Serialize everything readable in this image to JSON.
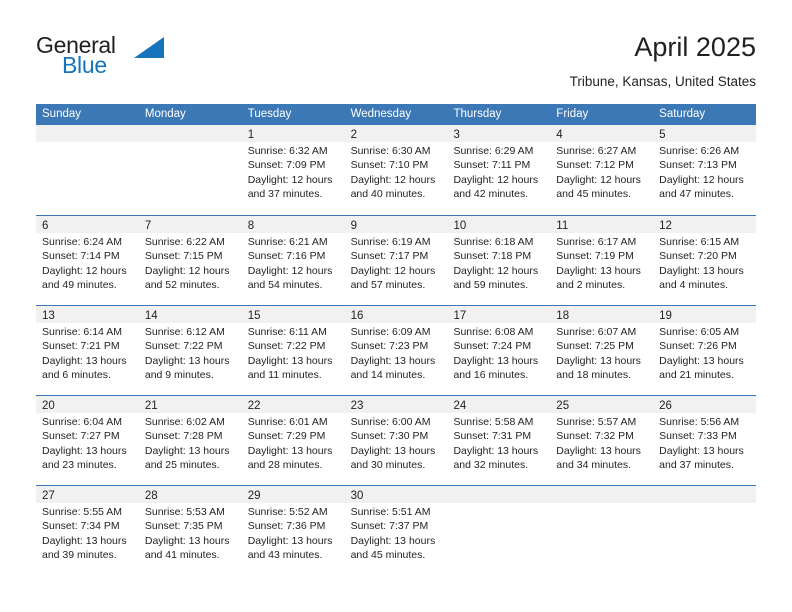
{
  "brand": {
    "word1": "General",
    "word2": "Blue",
    "triangle_color": "#1574bb",
    "text_color": "#231f20"
  },
  "header": {
    "title": "April 2025",
    "location": "Tribune, Kansas, United States"
  },
  "theme": {
    "header_blue": "#3b78b5",
    "daynum_strip": "#f1f1f1",
    "cell_bg": "#ffffff",
    "text": "#231f20"
  },
  "calendar": {
    "weekdays": [
      "Sunday",
      "Monday",
      "Tuesday",
      "Wednesday",
      "Thursday",
      "Friday",
      "Saturday"
    ],
    "weeks": [
      [
        {
          "day": "",
          "lines": []
        },
        {
          "day": "",
          "lines": []
        },
        {
          "day": "1",
          "lines": [
            "Sunrise: 6:32 AM",
            "Sunset: 7:09 PM",
            "Daylight: 12 hours",
            "and 37 minutes."
          ]
        },
        {
          "day": "2",
          "lines": [
            "Sunrise: 6:30 AM",
            "Sunset: 7:10 PM",
            "Daylight: 12 hours",
            "and 40 minutes."
          ]
        },
        {
          "day": "3",
          "lines": [
            "Sunrise: 6:29 AM",
            "Sunset: 7:11 PM",
            "Daylight: 12 hours",
            "and 42 minutes."
          ]
        },
        {
          "day": "4",
          "lines": [
            "Sunrise: 6:27 AM",
            "Sunset: 7:12 PM",
            "Daylight: 12 hours",
            "and 45 minutes."
          ]
        },
        {
          "day": "5",
          "lines": [
            "Sunrise: 6:26 AM",
            "Sunset: 7:13 PM",
            "Daylight: 12 hours",
            "and 47 minutes."
          ]
        }
      ],
      [
        {
          "day": "6",
          "lines": [
            "Sunrise: 6:24 AM",
            "Sunset: 7:14 PM",
            "Daylight: 12 hours",
            "and 49 minutes."
          ]
        },
        {
          "day": "7",
          "lines": [
            "Sunrise: 6:22 AM",
            "Sunset: 7:15 PM",
            "Daylight: 12 hours",
            "and 52 minutes."
          ]
        },
        {
          "day": "8",
          "lines": [
            "Sunrise: 6:21 AM",
            "Sunset: 7:16 PM",
            "Daylight: 12 hours",
            "and 54 minutes."
          ]
        },
        {
          "day": "9",
          "lines": [
            "Sunrise: 6:19 AM",
            "Sunset: 7:17 PM",
            "Daylight: 12 hours",
            "and 57 minutes."
          ]
        },
        {
          "day": "10",
          "lines": [
            "Sunrise: 6:18 AM",
            "Sunset: 7:18 PM",
            "Daylight: 12 hours",
            "and 59 minutes."
          ]
        },
        {
          "day": "11",
          "lines": [
            "Sunrise: 6:17 AM",
            "Sunset: 7:19 PM",
            "Daylight: 13 hours",
            "and 2 minutes."
          ]
        },
        {
          "day": "12",
          "lines": [
            "Sunrise: 6:15 AM",
            "Sunset: 7:20 PM",
            "Daylight: 13 hours",
            "and 4 minutes."
          ]
        }
      ],
      [
        {
          "day": "13",
          "lines": [
            "Sunrise: 6:14 AM",
            "Sunset: 7:21 PM",
            "Daylight: 13 hours",
            "and 6 minutes."
          ]
        },
        {
          "day": "14",
          "lines": [
            "Sunrise: 6:12 AM",
            "Sunset: 7:22 PM",
            "Daylight: 13 hours",
            "and 9 minutes."
          ]
        },
        {
          "day": "15",
          "lines": [
            "Sunrise: 6:11 AM",
            "Sunset: 7:22 PM",
            "Daylight: 13 hours",
            "and 11 minutes."
          ]
        },
        {
          "day": "16",
          "lines": [
            "Sunrise: 6:09 AM",
            "Sunset: 7:23 PM",
            "Daylight: 13 hours",
            "and 14 minutes."
          ]
        },
        {
          "day": "17",
          "lines": [
            "Sunrise: 6:08 AM",
            "Sunset: 7:24 PM",
            "Daylight: 13 hours",
            "and 16 minutes."
          ]
        },
        {
          "day": "18",
          "lines": [
            "Sunrise: 6:07 AM",
            "Sunset: 7:25 PM",
            "Daylight: 13 hours",
            "and 18 minutes."
          ]
        },
        {
          "day": "19",
          "lines": [
            "Sunrise: 6:05 AM",
            "Sunset: 7:26 PM",
            "Daylight: 13 hours",
            "and 21 minutes."
          ]
        }
      ],
      [
        {
          "day": "20",
          "lines": [
            "Sunrise: 6:04 AM",
            "Sunset: 7:27 PM",
            "Daylight: 13 hours",
            "and 23 minutes."
          ]
        },
        {
          "day": "21",
          "lines": [
            "Sunrise: 6:02 AM",
            "Sunset: 7:28 PM",
            "Daylight: 13 hours",
            "and 25 minutes."
          ]
        },
        {
          "day": "22",
          "lines": [
            "Sunrise: 6:01 AM",
            "Sunset: 7:29 PM",
            "Daylight: 13 hours",
            "and 28 minutes."
          ]
        },
        {
          "day": "23",
          "lines": [
            "Sunrise: 6:00 AM",
            "Sunset: 7:30 PM",
            "Daylight: 13 hours",
            "and 30 minutes."
          ]
        },
        {
          "day": "24",
          "lines": [
            "Sunrise: 5:58 AM",
            "Sunset: 7:31 PM",
            "Daylight: 13 hours",
            "and 32 minutes."
          ]
        },
        {
          "day": "25",
          "lines": [
            "Sunrise: 5:57 AM",
            "Sunset: 7:32 PM",
            "Daylight: 13 hours",
            "and 34 minutes."
          ]
        },
        {
          "day": "26",
          "lines": [
            "Sunrise: 5:56 AM",
            "Sunset: 7:33 PM",
            "Daylight: 13 hours",
            "and 37 minutes."
          ]
        }
      ],
      [
        {
          "day": "27",
          "lines": [
            "Sunrise: 5:55 AM",
            "Sunset: 7:34 PM",
            "Daylight: 13 hours",
            "and 39 minutes."
          ]
        },
        {
          "day": "28",
          "lines": [
            "Sunrise: 5:53 AM",
            "Sunset: 7:35 PM",
            "Daylight: 13 hours",
            "and 41 minutes."
          ]
        },
        {
          "day": "29",
          "lines": [
            "Sunrise: 5:52 AM",
            "Sunset: 7:36 PM",
            "Daylight: 13 hours",
            "and 43 minutes."
          ]
        },
        {
          "day": "30",
          "lines": [
            "Sunrise: 5:51 AM",
            "Sunset: 7:37 PM",
            "Daylight: 13 hours",
            "and 45 minutes."
          ]
        },
        {
          "day": "",
          "lines": []
        },
        {
          "day": "",
          "lines": []
        },
        {
          "day": "",
          "lines": []
        }
      ]
    ]
  }
}
